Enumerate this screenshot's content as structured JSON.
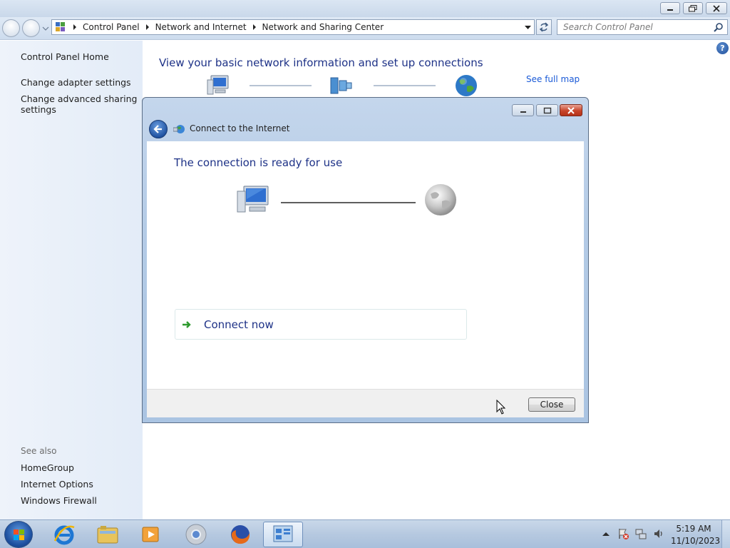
{
  "address_bar": {
    "crumbs": [
      "Control Panel",
      "Network and Internet",
      "Network and Sharing Center"
    ]
  },
  "search": {
    "placeholder": "Search Control Panel"
  },
  "sidebar": {
    "links": [
      "Control Panel Home",
      "Change adapter settings",
      "Change advanced sharing settings"
    ],
    "see_also_heading": "See also",
    "see_also": [
      "HomeGroup",
      "Internet Options",
      "Windows Firewall"
    ]
  },
  "main": {
    "title": "View your basic network information and set up connections",
    "see_full_map": "See full map"
  },
  "dialog": {
    "title": "Connect to the Internet",
    "heading": "The connection is ready for use",
    "connect_now": "Connect now",
    "close_button": "Close"
  },
  "help_label": "?",
  "taskbar": {
    "time": "5:19 AM",
    "date": "11/10/2023"
  },
  "colors": {
    "accent_blue": "#1e3287",
    "link_blue": "#1a5ad7",
    "sidebar_bg": "#e3ecf8"
  }
}
